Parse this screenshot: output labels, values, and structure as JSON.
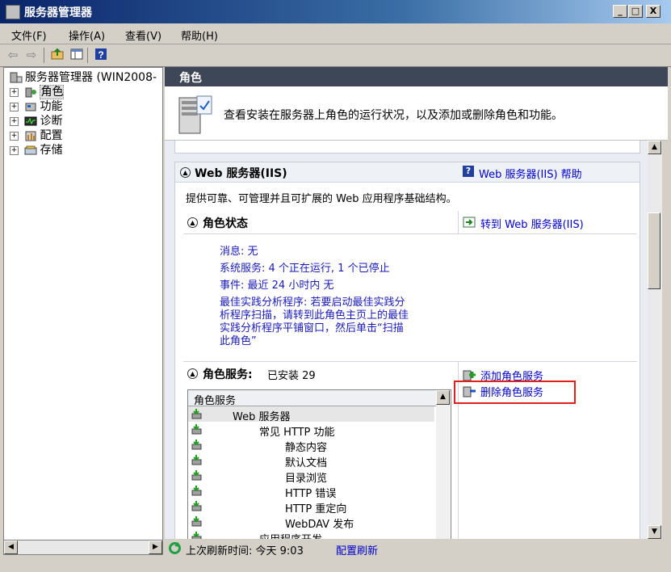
{
  "window": {
    "title": "服务器管理器",
    "min": "_",
    "max": "□",
    "close": "X"
  },
  "menu": [
    "文件(F)",
    "操作(A)",
    "查看(V)",
    "帮助(H)"
  ],
  "tree": {
    "root": "服务器管理器 (WIN2008-",
    "items": [
      {
        "label": "角色",
        "expander": "+"
      },
      {
        "label": "功能",
        "expander": "+"
      },
      {
        "label": "诊断",
        "expander": "+"
      },
      {
        "label": "配置",
        "expander": "+"
      },
      {
        "label": "存储",
        "expander": "+"
      }
    ]
  },
  "panel": {
    "header": "角色",
    "banner_text": "查看安装在服务器上角色的运行状况，以及添加或删除角色和功能。"
  },
  "web": {
    "title": "Web 服务器(IIS)",
    "help_link": "Web 服务器(IIS) 帮助",
    "description": "提供可靠、可管理并且可扩展的 Web 应用程序基础结构。",
    "status_title": "角色状态",
    "goto_link": "转到 Web 服务器(IIS)",
    "status_lines": [
      "消息: 无",
      "系统服务: 4 个正在运行, 1 个已停止",
      "事件: 最近 24 小时内 无"
    ],
    "bpa_text": [
      "最佳实践分析程序: 若要启动最佳实践分",
      "析程序扫描，请转到此角色主页上的最佳",
      "实践分析程序平铺窗口，然后单击“扫描",
      "此角色”"
    ],
    "services_title": "角色服务:",
    "services_installed": "已安装 29",
    "add_link": "添加角色服务",
    "remove_link": "删除角色服务",
    "list_header": "角色服务",
    "list": [
      {
        "label": "Web 服务器",
        "indent": 0
      },
      {
        "label": "常见 HTTP 功能",
        "indent": 1
      },
      {
        "label": "静态内容",
        "indent": 2
      },
      {
        "label": "默认文档",
        "indent": 2
      },
      {
        "label": "目录浏览",
        "indent": 2
      },
      {
        "label": "HTTP 错误",
        "indent": 2
      },
      {
        "label": "HTTP 重定向",
        "indent": 2
      },
      {
        "label": "WebDAV 发布",
        "indent": 2
      },
      {
        "label": "应用程序开发",
        "indent": 1
      }
    ]
  },
  "status": {
    "last_refresh": "上次刷新时间: 今天 9:03",
    "config_refresh": "配置刷新"
  },
  "colors": {
    "title_bar": "#0a246a",
    "highlight": "#e02020",
    "link": "#0000cc",
    "status_text": "#1a1ab8"
  }
}
